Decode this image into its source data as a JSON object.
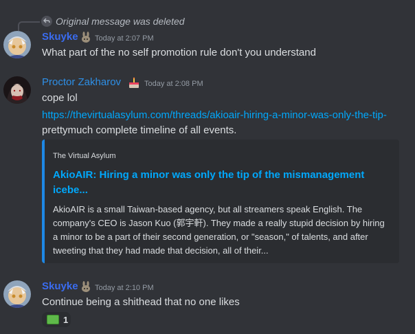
{
  "reply": {
    "text": "Original message was deleted",
    "icon": "reply-arrow-icon"
  },
  "messages": [
    {
      "author": "Skuyke",
      "author_color": "#3a6cf0",
      "badge_icon": "bunny-badge-icon",
      "timestamp": "Today at 2:07 PM",
      "lines": [
        "What part of the no self promotion rule don't you understand"
      ]
    },
    {
      "author": "Proctor Zakharov",
      "author_color": "#2e8fe6",
      "badge_icon": "cake-badge-icon",
      "timestamp": "Today at 2:08 PM",
      "lines": [
        "cope lol",
        "https://thevirtualasylum.com/threads/akioair-hiring-a-minor-was-only-the-tip-",
        "prettymuch complete timeline of all events."
      ],
      "embed": {
        "provider": "The Virtual Asylum",
        "title": "AkioAIR: Hiring a minor was only the tip of the mismanagement icebe...",
        "description": "AkioAIR is a small Taiwan-based agency, but all streamers speak English. The company's CEO is Jason Kuo (郭宇軒). They made a really stupid decision by hiring a minor to be a part of their second generation, or \"season,\" of talents, and after tweeting that they had made that decision, all of their...",
        "accent_color": "#1e88e5"
      }
    },
    {
      "author": "Skuyke",
      "author_color": "#3a6cf0",
      "badge_icon": "bunny-badge-icon",
      "timestamp": "Today at 2:10 PM",
      "lines": [
        "Continue being a shithead that no one likes"
      ],
      "reaction": {
        "emoji": "money-bill-emoji",
        "count": "1"
      }
    }
  ]
}
